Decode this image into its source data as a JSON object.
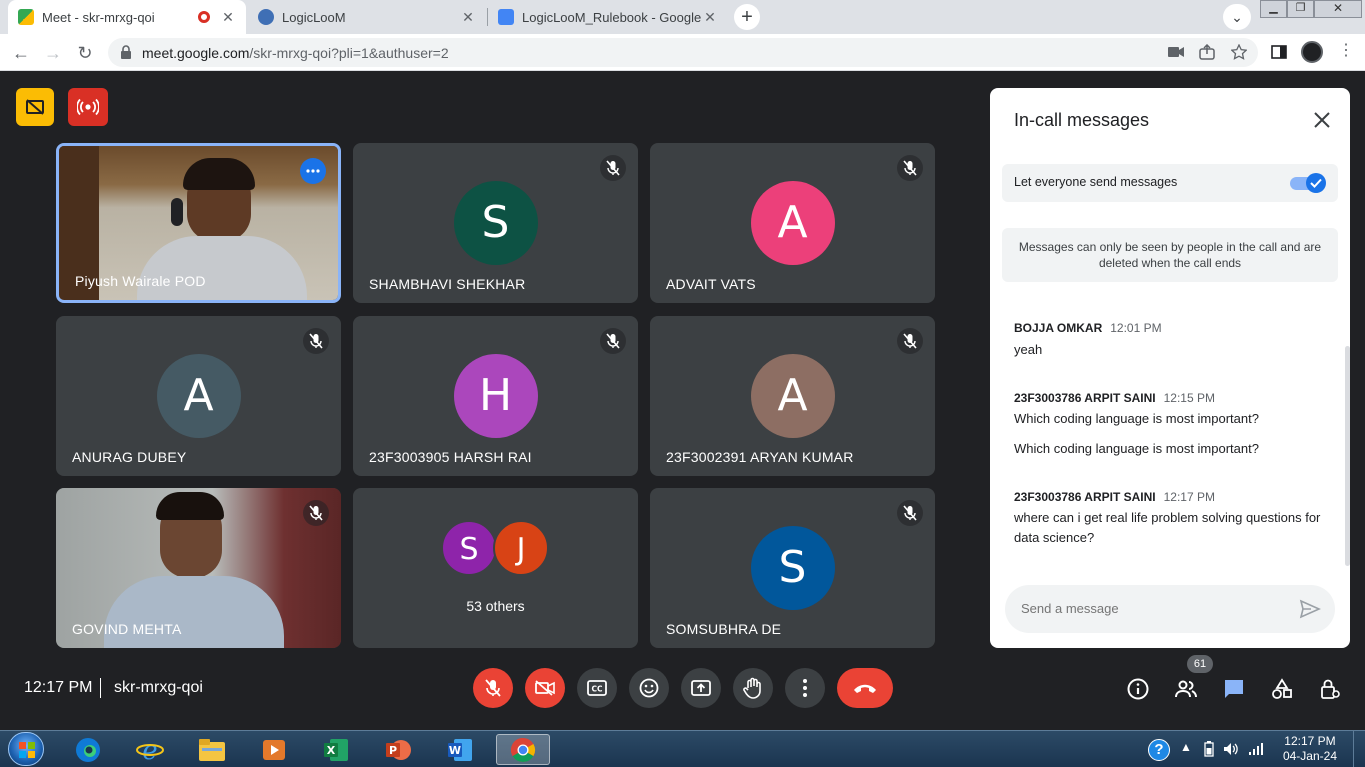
{
  "browser": {
    "tabs": [
      {
        "title": "Meet - skr-mrxg-qoi",
        "active": true,
        "recording": true
      },
      {
        "title": "LogicLooM",
        "active": false
      },
      {
        "title": "LogicLooM_Rulebook - Google D",
        "active": false
      }
    ],
    "url_host": "meet.google.com",
    "url_path": "/skr-mrxg-qoi?pli=1&authuser=2"
  },
  "tiles": [
    {
      "name": "Piyush Wairale POD",
      "type": "video",
      "highlight": true
    },
    {
      "name": "SHAMBHAVI SHEKHAR",
      "initial": "S",
      "color": "#0d5244",
      "muted": true
    },
    {
      "name": "ADVAIT VATS",
      "initial": "A",
      "color": "#ec407a",
      "muted": true
    },
    {
      "name": "ANURAG DUBEY",
      "initial": "A",
      "color": "#455a64",
      "muted": true
    },
    {
      "name": "23F3003905 HARSH RAI",
      "initial": "H",
      "color": "#ab47bc",
      "muted": true
    },
    {
      "name": "23F3002391 ARYAN KUMAR",
      "initial": "A",
      "color": "#8d6e63",
      "muted": true
    },
    {
      "name": "GOVIND MEHTA",
      "type": "video",
      "muted": true
    },
    {
      "name": "53 others",
      "type": "others",
      "initials": [
        "S",
        "J"
      ],
      "colors": [
        "#8e24aa",
        "#d84315"
      ]
    },
    {
      "name": "SOMSUBHRA DE",
      "initial": "S",
      "color": "#01579b",
      "muted": true
    }
  ],
  "panel": {
    "title": "In-call messages",
    "setting_label": "Let everyone send messages",
    "notice": "Messages can only be seen by people in the call and are deleted when the call ends",
    "messages": [
      {
        "sender": "BOJJA OMKAR",
        "time": "12:01 PM",
        "lines": [
          "yeah"
        ]
      },
      {
        "sender": "23F3003786 ARPIT SAINI",
        "time": "12:15 PM",
        "lines": [
          "Which coding language is most important?",
          "Which coding language is most important?"
        ]
      },
      {
        "sender": "23F3003786 ARPIT SAINI",
        "time": "12:17 PM",
        "lines": [
          "where can i get real life problem solving questions for data science?"
        ]
      }
    ],
    "input_placeholder": "Send a message"
  },
  "bottom": {
    "time": "12:17 PM",
    "meeting_code": "skr-mrxg-qoi",
    "participant_count": "61"
  },
  "taskbar": {
    "clock_time": "12:17 PM",
    "clock_date": "04-Jan-24"
  }
}
